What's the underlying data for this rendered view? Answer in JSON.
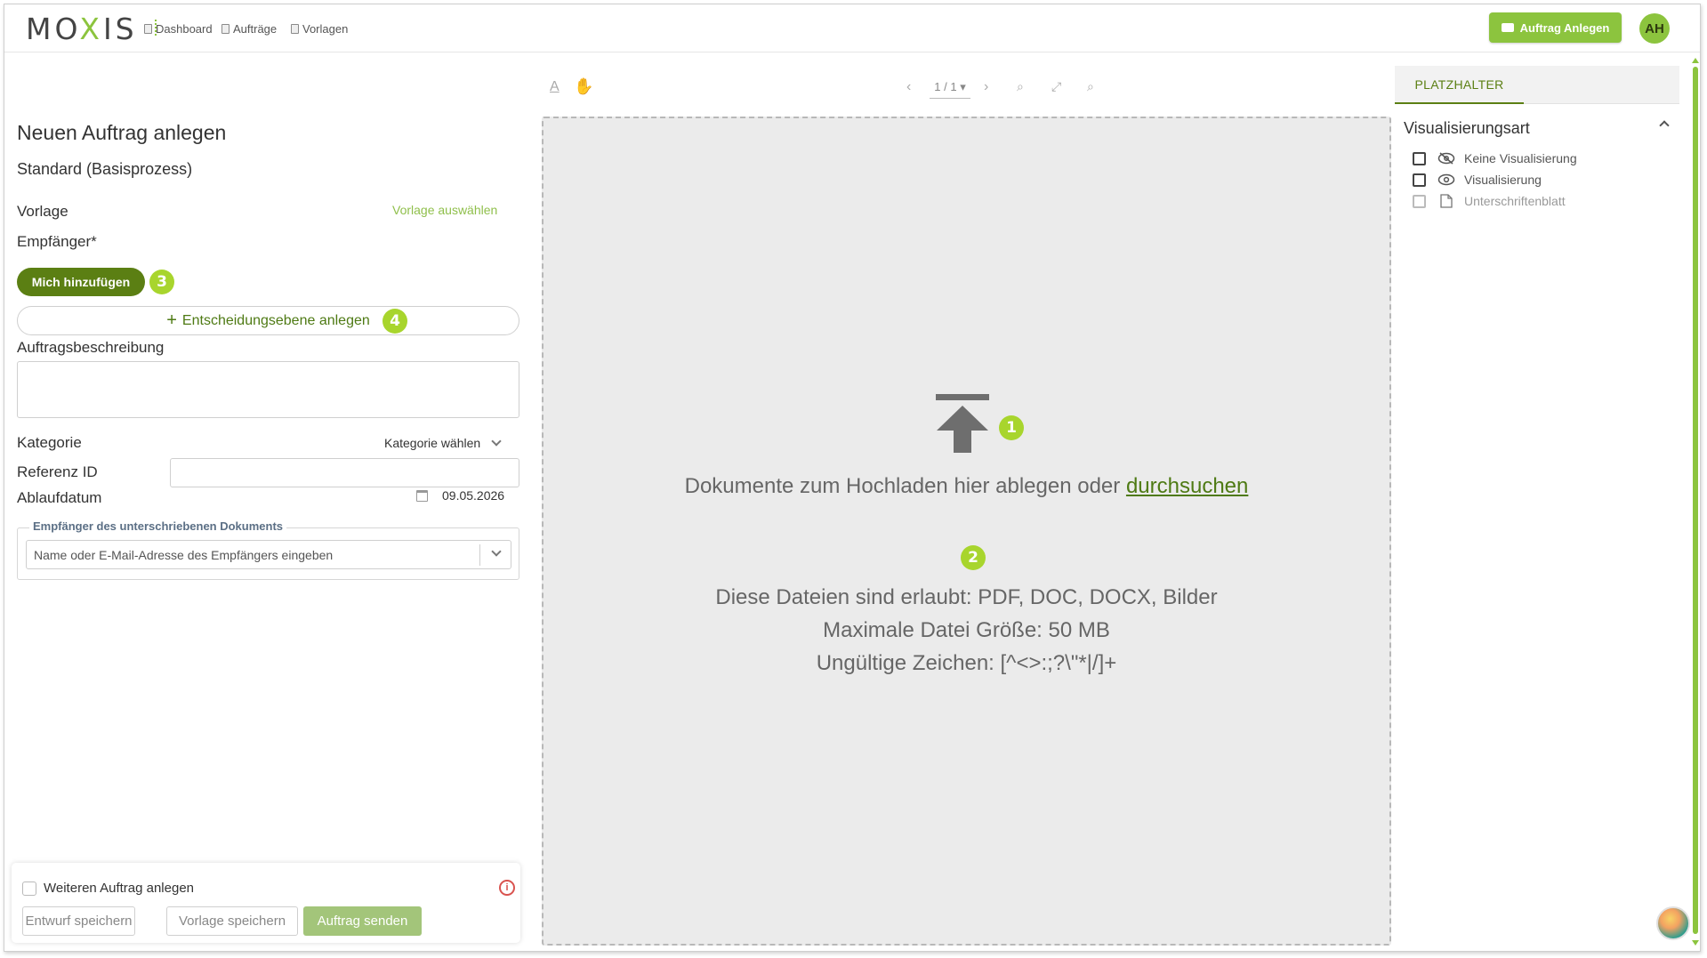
{
  "header": {
    "logo": "MOXIS",
    "nav": [
      {
        "label": "Dashboard",
        "icon": "document-icon"
      },
      {
        "label": "Aufträge",
        "icon": "document-icon"
      },
      {
        "label": "Vorlagen",
        "icon": "document-icon"
      }
    ],
    "new_order_button": "Auftrag Anlegen",
    "avatar_initials": "AH",
    "accent_color": "#8cc43e"
  },
  "form": {
    "title": "Neuen Auftrag anlegen",
    "process": "Standard (Basisprozess)",
    "template_label": "Vorlage",
    "template_link": "Vorlage auswählen",
    "recipients_label": "Empfänger*",
    "add_me_button": "Mich hinzufügen",
    "add_level_button": "Entscheidungsebene anlegen",
    "description_label": "Auftragsbeschreibung",
    "description_value": "",
    "category_label": "Kategorie",
    "category_select": "Kategorie wählen",
    "reference_label": "Referenz ID",
    "reference_value": "",
    "expiry_label": "Ablaufdatum",
    "expiry_value": "09.05.2026",
    "signed_recipient_legend": "Empfänger des unterschriebenen Dokuments",
    "signed_recipient_placeholder": "Name oder E-Mail-Adresse des Empfängers eingeben"
  },
  "footer_card": {
    "another_order_label": "Weiteren Auftrag anlegen",
    "another_order_checked": false,
    "save_draft": "Entwurf speichern",
    "save_template": "Vorlage speichern",
    "send_order": "Auftrag senden"
  },
  "viewer": {
    "page_indicator": "1 / 1",
    "drop_text": "Dokumente zum Hochladen hier ablegen oder ",
    "browse_link": "durchsuchen",
    "allowed_files": "Diese Dateien sind erlaubt: PDF, DOC, DOCX, Bilder",
    "max_size": "Maximale Datei Größe: 50 MB",
    "invalid_chars": "Ungültige Zeichen: [^<>:;?\\\"*|/]+"
  },
  "right_panel": {
    "tab": "PLATZHALTER",
    "section_title": "Visualisierungsart",
    "options": [
      {
        "label": "Keine Visualisierung",
        "icon": "eye-off-icon",
        "enabled": true,
        "checked": false
      },
      {
        "label": "Visualisierung",
        "icon": "eye-icon",
        "enabled": true,
        "checked": false
      },
      {
        "label": "Unterschriftenblatt",
        "icon": "page-icon",
        "enabled": false,
        "checked": false
      }
    ]
  },
  "badges": [
    "1",
    "2",
    "3",
    "4"
  ]
}
